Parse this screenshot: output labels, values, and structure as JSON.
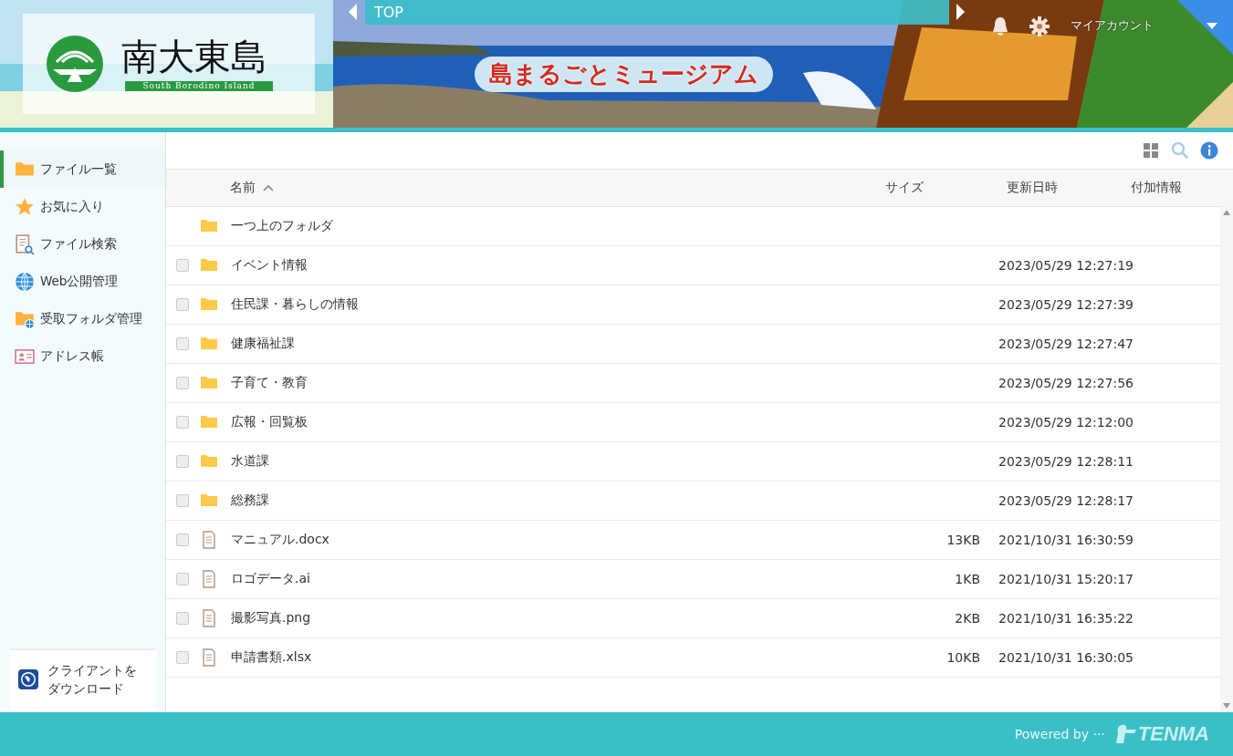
{
  "header": {
    "logo_title": "南大東島",
    "logo_subtitle": "South Borodino Island",
    "banner_title": "島まるごとミュージアム",
    "breadcrumb": "TOP",
    "account": "マイアカウント"
  },
  "sidebar": {
    "items": [
      {
        "label": "ファイル一覧",
        "selected": true
      },
      {
        "label": "お気に入り",
        "selected": false
      },
      {
        "label": "ファイル検索",
        "selected": false
      },
      {
        "label": "Web公開管理",
        "selected": false
      },
      {
        "label": "受取フォルダ管理",
        "selected": false
      },
      {
        "label": "アドレス帳",
        "selected": false
      }
    ],
    "download": [
      "クライアントを",
      "ダウンロード"
    ]
  },
  "table": {
    "columns": [
      "名前",
      "サイズ",
      "更新日時",
      "付加情報"
    ],
    "rows": [
      {
        "kind": "parent",
        "name": "一つ上のフォルダ"
      },
      {
        "kind": "folder",
        "name": "イベント情報",
        "checked": false,
        "date": "2023/05/29 12:27:19"
      },
      {
        "kind": "folder",
        "name": "住民課・暮らしの情報",
        "checked": false,
        "date": "2023/05/29 12:27:39"
      },
      {
        "kind": "folder",
        "name": "健康福祉課",
        "checked": false,
        "date": "2023/05/29 12:27:47"
      },
      {
        "kind": "folder",
        "name": "子育て・教育",
        "checked": false,
        "date": "2023/05/29 12:27:56"
      },
      {
        "kind": "folder",
        "name": "広報・回覧板",
        "checked": false,
        "date": "2023/05/29 12:12:00"
      },
      {
        "kind": "folder",
        "name": "水道課",
        "checked": false,
        "date": "2023/05/29 12:28:11"
      },
      {
        "kind": "folder",
        "name": "総務課",
        "checked": false,
        "date": "2023/05/29 12:28:17"
      },
      {
        "kind": "file",
        "name": "マニュアル.docx",
        "checked": false,
        "size": "13KB",
        "date": "2021/10/31 16:30:59"
      },
      {
        "kind": "file",
        "name": "ロゴデータ.ai",
        "checked": false,
        "size": "1KB",
        "date": "2021/10/31 15:20:17"
      },
      {
        "kind": "file",
        "name": "撮影写真.png",
        "checked": false,
        "size": "2KB",
        "date": "2021/10/31 16:35:22"
      },
      {
        "kind": "file",
        "name": "申請書類.xlsx",
        "checked": false,
        "size": "10KB",
        "date": "2021/10/31 16:30:05"
      }
    ]
  },
  "footer": {
    "powered": "Powered by ···",
    "brand": "TENMA"
  }
}
